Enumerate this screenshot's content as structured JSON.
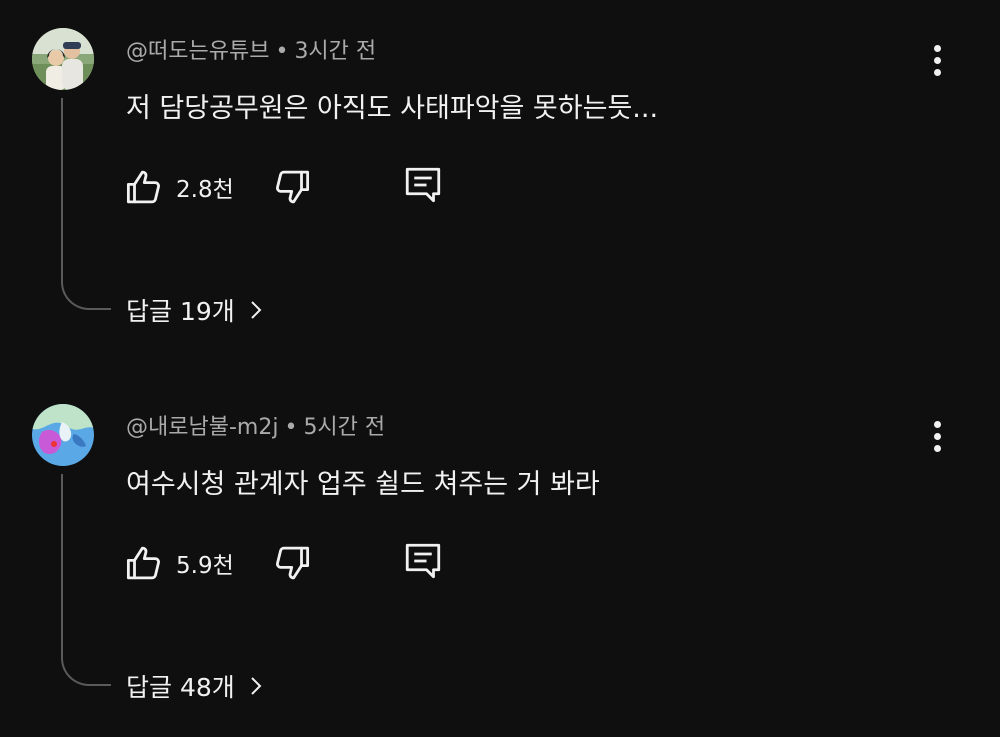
{
  "comments": [
    {
      "author": "@떠도는유튜브",
      "separator": "•",
      "time": "3시간 전",
      "text": "저 담당공무원은 아직도 사태파악을 못하는듯...",
      "likes": "2.8천",
      "replies_label": "답글 19개",
      "avatar_icon": "couple-photo-avatar"
    },
    {
      "author": "@내로남불-m2j",
      "separator": "•",
      "time": "5시간 전",
      "text": "여수시청 관계자 업주 쉴드 쳐주는 거 봐라",
      "likes": "5.9천",
      "replies_label": "답글 48개",
      "avatar_icon": "map-avatar"
    }
  ],
  "icons": {
    "like": "thumbs-up-icon",
    "dislike": "thumbs-down-icon",
    "reply": "comment-reply-icon",
    "more": "more-vertical-icon",
    "chevron": "chevron-right-icon"
  },
  "colors": {
    "background": "#0f0f0f",
    "text": "#f1f1f1",
    "meta": "#aaaaaa",
    "thread_line": "#5a5a5a"
  }
}
